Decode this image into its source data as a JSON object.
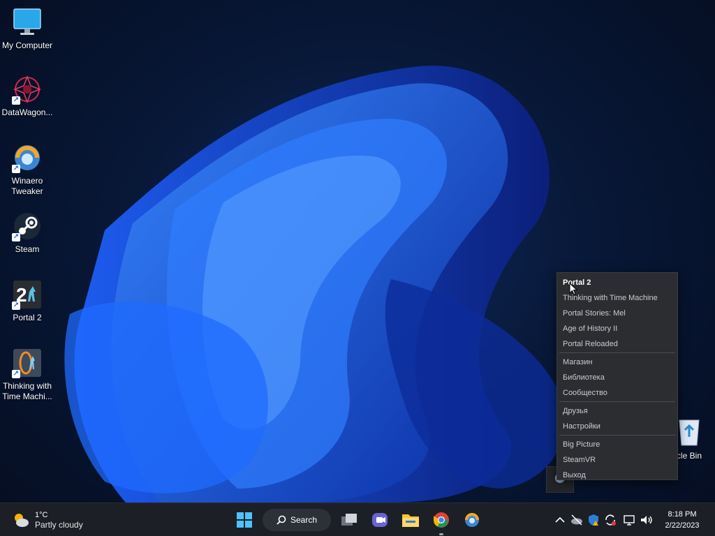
{
  "desktop": {
    "icons": [
      {
        "label": "My Computer",
        "icon": "monitor-icon"
      },
      {
        "label": "DataWagon...",
        "icon": "datawagon-icon"
      },
      {
        "label": "Winaero\nTweaker",
        "icon": "winaero-icon"
      },
      {
        "label": "Steam",
        "icon": "steam-icon"
      },
      {
        "label": "Portal 2",
        "icon": "portal2-icon"
      },
      {
        "label": "Thinking with\nTime Machi...",
        "icon": "thinking-icon"
      }
    ],
    "recycle_bin_label": "cle Bin"
  },
  "context_menu": {
    "group1": [
      "Portal 2",
      "Thinking with Time Machine",
      "Portal Stories: Mel",
      "Age of History II",
      "Portal Reloaded"
    ],
    "group2": [
      "Магазин",
      "Библиотека",
      "Сообщество"
    ],
    "group3": [
      "Друзья",
      "Настройки"
    ],
    "group4": [
      "Big Picture",
      "SteamVR",
      "Выход"
    ]
  },
  "taskbar": {
    "weather": {
      "temp": "1°C",
      "condition": "Partly cloudy"
    },
    "search_label": "Search",
    "clock": {
      "time": "8:18 PM",
      "date": "2/22/2023"
    }
  },
  "colors": {
    "accent": "#1a5fd6",
    "menu_bg": "#2b2d31",
    "taskbar_bg": "#1c1f26"
  }
}
